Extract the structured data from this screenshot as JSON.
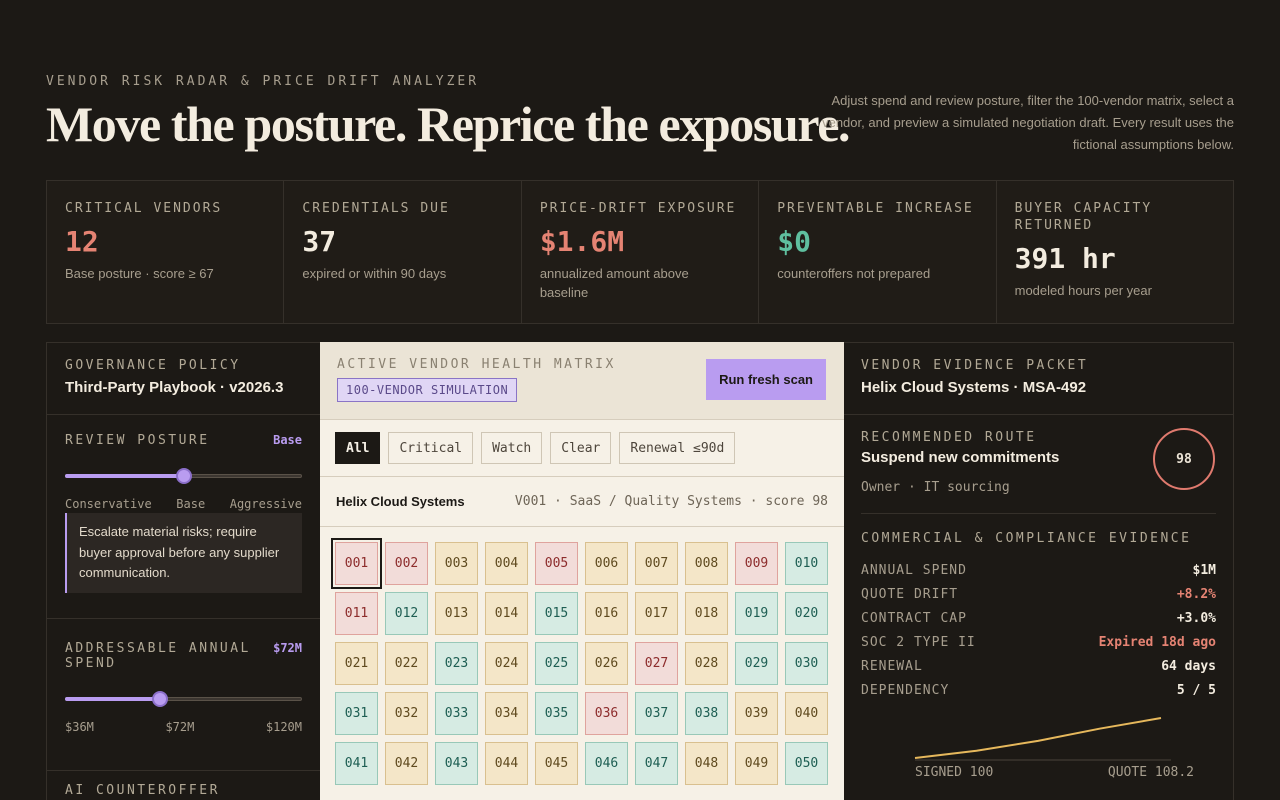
{
  "header": {
    "eyebrow": "VENDOR RISK RADAR & PRICE DRIFT ANALYZER",
    "title": "Move the posture. Reprice the exposure.",
    "intro": "Adjust spend and review posture, filter the 100-vendor matrix, select a vendor, and preview a simulated negotiation draft. Every result uses the fictional assumptions below."
  },
  "kpis": [
    {
      "label": "CRITICAL VENDORS",
      "value": "12",
      "sub": "Base posture · score ≥ 67",
      "color": "#e58373"
    },
    {
      "label": "CREDENTIALS DUE",
      "value": "37",
      "sub": "expired or within 90 days",
      "color": "#f3ecdf"
    },
    {
      "label": "PRICE-DRIFT EXPOSURE",
      "value": "$1.6M",
      "sub": "annualized amount above baseline",
      "color": "#e58373"
    },
    {
      "label": "PREVENTABLE INCREASE",
      "value": "$0",
      "sub": "counteroffers not prepared",
      "color": "#5fbf9f"
    },
    {
      "label": "BUYER CAPACITY RETURNED",
      "value": "391 hr",
      "sub": "modeled hours per year",
      "color": "#f3ecdf"
    }
  ],
  "governance": {
    "label": "GOVERNANCE POLICY",
    "title": "Third-Party Playbook · v2026.3"
  },
  "posture": {
    "label": "REVIEW POSTURE",
    "value": "Base",
    "level": 0.5,
    "ticks": [
      "Conservative",
      "Base",
      "Aggressive"
    ],
    "callout": "Escalate material risks; require buyer approval before any supplier communication."
  },
  "spend": {
    "label": "ADDRESSABLE ANNUAL SPEND",
    "value": "$72M",
    "level": 0.4,
    "ticks": [
      "$36M",
      "$72M",
      "$120M"
    ]
  },
  "counteroffer": {
    "label": "AI COUNTEROFFER"
  },
  "matrix": {
    "label": "ACTIVE VENDOR HEALTH MATRIX",
    "badge": "100-VENDOR SIMULATION",
    "run_label": "Run fresh scan",
    "filters": [
      "All",
      "Critical",
      "Watch",
      "Clear",
      "Renewal ≤90d"
    ],
    "active_filter": 0,
    "selected_name": "Helix Cloud Systems",
    "selected_meta": "V001 · SaaS / Quality Systems · score 98",
    "cells": [
      {
        "id": "001",
        "s": "critical"
      },
      {
        "id": "002",
        "s": "critical"
      },
      {
        "id": "003",
        "s": "watch"
      },
      {
        "id": "004",
        "s": "watch"
      },
      {
        "id": "005",
        "s": "critical"
      },
      {
        "id": "006",
        "s": "watch"
      },
      {
        "id": "007",
        "s": "watch"
      },
      {
        "id": "008",
        "s": "watch"
      },
      {
        "id": "009",
        "s": "critical"
      },
      {
        "id": "010",
        "s": "clear"
      },
      {
        "id": "011",
        "s": "critical"
      },
      {
        "id": "012",
        "s": "clear"
      },
      {
        "id": "013",
        "s": "watch"
      },
      {
        "id": "014",
        "s": "watch"
      },
      {
        "id": "015",
        "s": "clear"
      },
      {
        "id": "016",
        "s": "watch"
      },
      {
        "id": "017",
        "s": "watch"
      },
      {
        "id": "018",
        "s": "watch"
      },
      {
        "id": "019",
        "s": "clear"
      },
      {
        "id": "020",
        "s": "clear"
      },
      {
        "id": "021",
        "s": "watch"
      },
      {
        "id": "022",
        "s": "watch"
      },
      {
        "id": "023",
        "s": "clear"
      },
      {
        "id": "024",
        "s": "watch"
      },
      {
        "id": "025",
        "s": "clear"
      },
      {
        "id": "026",
        "s": "watch"
      },
      {
        "id": "027",
        "s": "critical"
      },
      {
        "id": "028",
        "s": "watch"
      },
      {
        "id": "029",
        "s": "clear"
      },
      {
        "id": "030",
        "s": "clear"
      },
      {
        "id": "031",
        "s": "clear"
      },
      {
        "id": "032",
        "s": "watch"
      },
      {
        "id": "033",
        "s": "clear"
      },
      {
        "id": "034",
        "s": "watch"
      },
      {
        "id": "035",
        "s": "clear"
      },
      {
        "id": "036",
        "s": "critical"
      },
      {
        "id": "037",
        "s": "clear"
      },
      {
        "id": "038",
        "s": "clear"
      },
      {
        "id": "039",
        "s": "watch"
      },
      {
        "id": "040",
        "s": "watch"
      },
      {
        "id": "041",
        "s": "clear"
      },
      {
        "id": "042",
        "s": "watch"
      },
      {
        "id": "043",
        "s": "clear"
      },
      {
        "id": "044",
        "s": "watch"
      },
      {
        "id": "045",
        "s": "watch"
      },
      {
        "id": "046",
        "s": "clear"
      },
      {
        "id": "047",
        "s": "clear"
      },
      {
        "id": "048",
        "s": "watch"
      },
      {
        "id": "049",
        "s": "watch"
      },
      {
        "id": "050",
        "s": "clear"
      }
    ]
  },
  "evidence": {
    "label": "VENDOR EVIDENCE PACKET",
    "title": "Helix Cloud Systems · MSA-492",
    "route_label": "RECOMMENDED ROUTE",
    "route_title": "Suspend new commitments",
    "owner": "Owner · IT sourcing",
    "score": "98",
    "section_label": "COMMERCIAL & COMPLIANCE EVIDENCE",
    "rows": [
      {
        "k": "ANNUAL SPEND",
        "v": "$1M",
        "bad": false
      },
      {
        "k": "QUOTE DRIFT",
        "v": "+8.2%",
        "bad": true
      },
      {
        "k": "CONTRACT CAP",
        "v": "+3.0%",
        "bad": false
      },
      {
        "k": "SOC 2 TYPE II",
        "v": "Expired 18d ago",
        "bad": true
      },
      {
        "k": "RENEWAL",
        "v": "64 days",
        "bad": false
      },
      {
        "k": "DEPENDENCY",
        "v": "5 / 5",
        "bad": false
      }
    ],
    "spark_start": "SIGNED 100",
    "spark_end": "QUOTE 108.2",
    "spark_values": [
      100,
      101.5,
      103.5,
      106,
      108.2
    ]
  }
}
